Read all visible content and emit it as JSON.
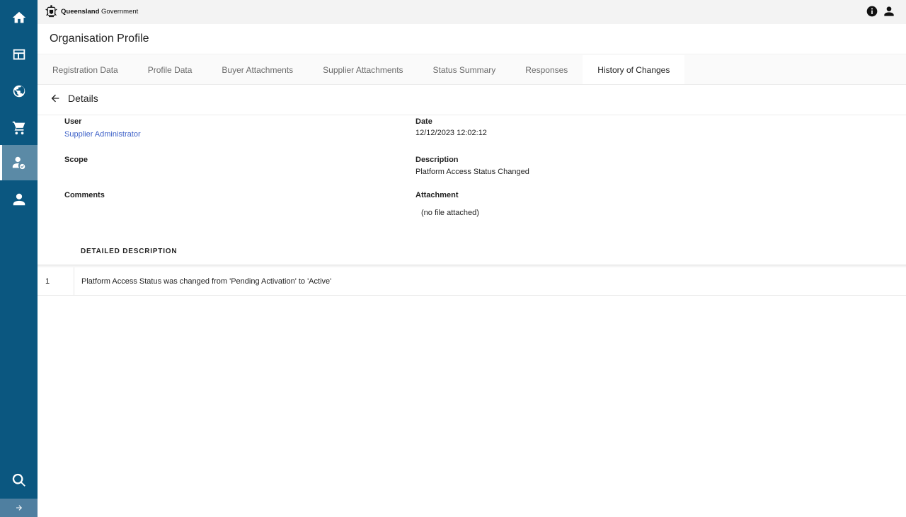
{
  "header": {
    "logo_strong": "Queensland",
    "logo_text": "Government"
  },
  "page": {
    "title": "Organisation Profile"
  },
  "tabs": [
    {
      "label": "Registration Data"
    },
    {
      "label": "Profile Data"
    },
    {
      "label": "Buyer Attachments"
    },
    {
      "label": "Supplier Attachments"
    },
    {
      "label": "Status Summary"
    },
    {
      "label": "Responses"
    },
    {
      "label": "History of Changes"
    }
  ],
  "details": {
    "title": "Details",
    "user_label": "User",
    "user_value": "Supplier Administrator",
    "date_label": "Date",
    "date_value": "12/12/2023 12:02:12",
    "scope_label": "Scope",
    "description_label": "Description",
    "description_value": "Platform Access Status Changed",
    "comments_label": "Comments",
    "attachment_label": "Attachment",
    "attachment_value": "(no file attached)"
  },
  "detailed_description": {
    "header": "DETAILED DESCRIPTION",
    "rows": [
      {
        "num": "1",
        "text": "Platform Access Status was changed from 'Pending Activation' to 'Active'"
      }
    ]
  },
  "icons": {
    "sidebar": [
      "home-icon",
      "dashboard-icon",
      "globe-icon",
      "cart-icon",
      "user-check-icon",
      "user-icon",
      "search-icon"
    ],
    "top": [
      "info-icon",
      "account-icon"
    ]
  },
  "colors": {
    "sidebar": "#0b5780",
    "sidebar_active": "#5b8aa6",
    "link": "#3f62c8"
  }
}
